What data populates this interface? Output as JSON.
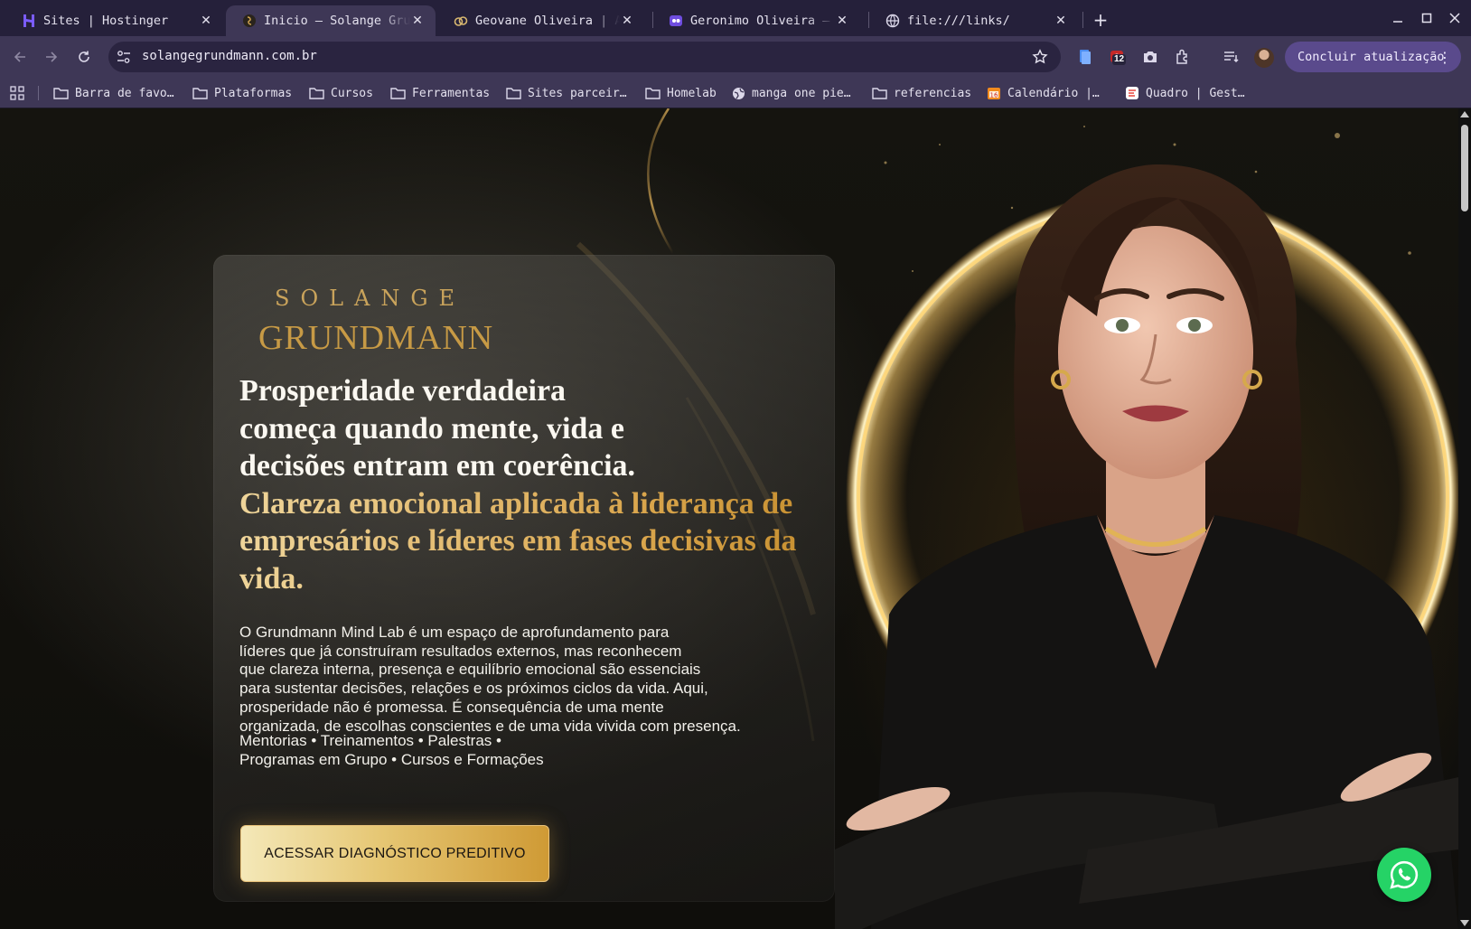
{
  "tabs": [
    {
      "title": "Sites | Hostinger",
      "icon": "hostinger-icon",
      "active": false
    },
    {
      "title": "Inicio – Solange Grundmann",
      "icon": "solange-favicon",
      "active": true
    },
    {
      "title": "Geovane Oliveira | Ad",
      "icon": "geovane-favicon",
      "active": false
    },
    {
      "title": "Geronimo Oliveira – D",
      "icon": "geronimo-favicon",
      "active": false
    },
    {
      "title": "file:///links/",
      "icon": "globe-icon",
      "active": false
    }
  ],
  "toolbar": {
    "url": "solangegrundmann.com.br",
    "extension_badge": "12",
    "update_label": "Concluir atualização"
  },
  "bookmarks": [
    {
      "label": "Barra de favo…",
      "icon": "folder-icon"
    },
    {
      "label": "Plataformas",
      "icon": "folder-icon"
    },
    {
      "label": "Cursos",
      "icon": "folder-icon"
    },
    {
      "label": "Ferramentas",
      "icon": "folder-icon"
    },
    {
      "label": "Sites parceir…",
      "icon": "folder-icon"
    },
    {
      "label": "Homelab",
      "icon": "folder-icon"
    },
    {
      "label": "manga one pie…",
      "icon": "globe-icon"
    },
    {
      "label": "referencias",
      "icon": "folder-icon"
    },
    {
      "label": "Calendário |…",
      "icon": "calendar-icon"
    },
    {
      "label": "Quadro | Gest…",
      "icon": "board-icon"
    }
  ],
  "hero": {
    "logo_top": "SOLANGE",
    "logo_bottom": "GRUNDMANN",
    "headline_white_1": "Prosperidade verdadeira",
    "headline_white_2": "começa quando mente, vida e",
    "headline_white_3": "decisões entram em coerência.",
    "headline_gold_1": "Clareza emocional aplicada à liderança de",
    "headline_gold_2": "empresários e líderes em fases decisivas da",
    "headline_gold_3": "vida.",
    "lead_lines": [
      "O Grundmann Mind Lab é um espaço de aprofundamento para",
      "líderes que já construíram resultados externos, mas reconhecem",
      "que clareza interna, presença e equilíbrio emocional são essenciais",
      "para sustentar decisões, relações e os próximos ciclos da vida. Aqui,",
      "prosperidade não é promessa. É consequência de uma mente",
      "organizada, de escolhas conscientes e de uma vida vivida com presença."
    ],
    "services_line_1": "Mentorias • Treinamentos • Palestras •",
    "services_line_2": "Programas em Grupo • Cursos e Formações",
    "cta_label": "ACESSAR DIAGNÓSTICO PREDITIVO"
  },
  "colors": {
    "accent_gold": "#d9a54c",
    "chrome_dark": "#25203a",
    "chrome_mid": "#3e3756",
    "update_button": "#5a4a8c",
    "whatsapp_green": "#25d366"
  }
}
